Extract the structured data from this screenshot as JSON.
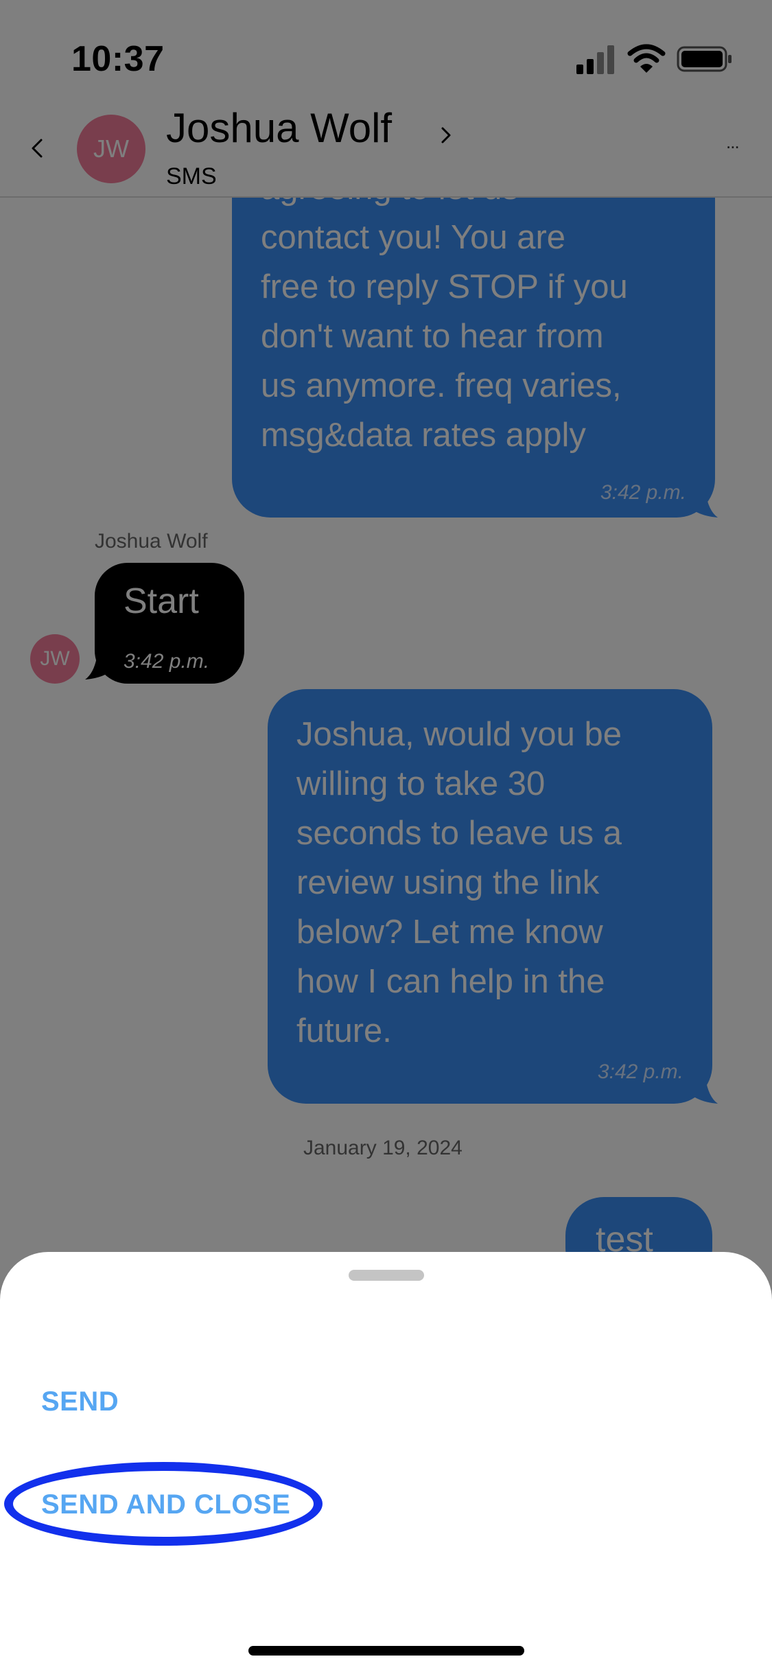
{
  "status_bar": {
    "time": "10:37"
  },
  "header": {
    "avatar_initials": "JW",
    "contact_name": "Joshua Wolf",
    "channel": "SMS",
    "more_label": "..."
  },
  "messages": [
    {
      "direction": "outgoing",
      "text": "agreeing to let us\ncontact you! You are\nfree to reply STOP if you\ndon't want to hear from\nus anymore. freq varies,\nmsg&data rates apply",
      "time": "3:42 p.m."
    },
    {
      "direction": "incoming",
      "sender": "Joshua Wolf",
      "avatar_initials": "JW",
      "text": "Start",
      "time": "3:42 p.m."
    },
    {
      "direction": "outgoing",
      "text": "Joshua, would you be\nwilling to take 30\nseconds to leave us a\nreview using the link\nbelow? Let me know\nhow I can help in the\nfuture.",
      "time": "3:42 p.m."
    }
  ],
  "date_separator": "January 19, 2024",
  "last_message": {
    "direction": "outgoing",
    "text": "test"
  },
  "sheet": {
    "send_label": "SEND",
    "send_and_close_label": "SEND AND CLOSE"
  },
  "colors": {
    "outgoing_bubble": "#3a8ff5",
    "incoming_bubble": "#000000",
    "avatar": "#f37c9a",
    "sheet_action": "#56a6f2",
    "highlight_ring": "#1230ec"
  }
}
